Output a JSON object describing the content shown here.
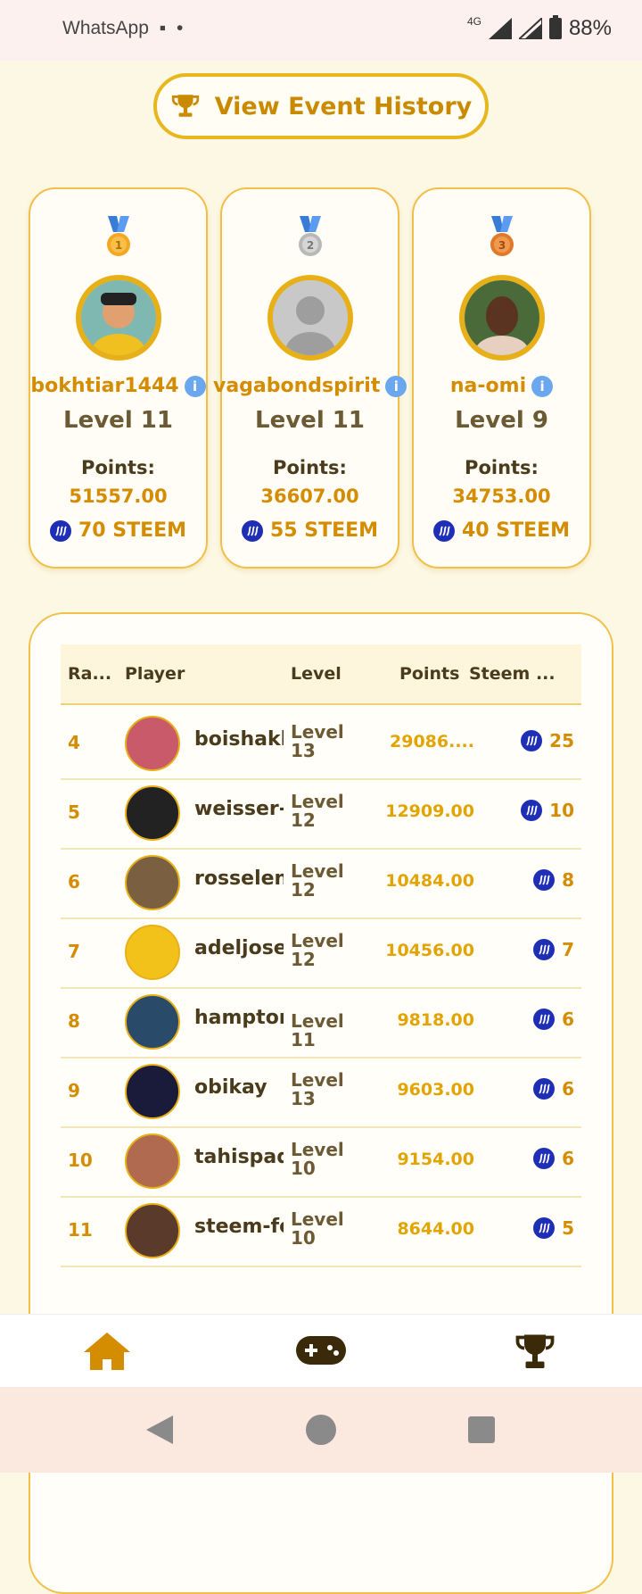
{
  "status_bar": {
    "left_text": "WhatsApp",
    "network": "4G",
    "battery": "88%"
  },
  "history_button": {
    "label": "View Event History"
  },
  "podium": [
    {
      "place": "1",
      "name": "bokhtiar1444",
      "level": "Level 11",
      "points_label": "Points:",
      "points": "51557.00",
      "reward": "70 STEEM",
      "medal_color": "#f5a623"
    },
    {
      "place": "2",
      "name": "vagabondspirit",
      "level": "Level 11",
      "points_label": "Points:",
      "points": "36607.00",
      "reward": "55 STEEM",
      "medal_color": "#b8b8b8"
    },
    {
      "place": "3",
      "name": "na-omi",
      "level": "Level 9",
      "points_label": "Points:",
      "points": "34753.00",
      "reward": "40 STEEM",
      "medal_color": "#e07a2a"
    }
  ],
  "table": {
    "headers": {
      "rank": "Ra...",
      "player": "Player",
      "level": "Level",
      "points": "Points",
      "steem": "Steem ..."
    },
    "rows": [
      {
        "rank": "4",
        "player": "boishakhi",
        "level": "Level 13",
        "points": "29086....",
        "steem": "25"
      },
      {
        "rank": "5",
        "player": "weisser-r",
        "level": "Level 12",
        "points": "12909.00",
        "steem": "10"
      },
      {
        "rank": "6",
        "player": "rosselena",
        "level": "Level 12",
        "points": "10484.00",
        "steem": "8"
      },
      {
        "rank": "7",
        "player": "adeljose",
        "level": "Level 12",
        "points": "10456.00",
        "steem": "7"
      },
      {
        "rank": "8",
        "player": "hamptonc",
        "level": "Level 11",
        "points": "9818.00",
        "steem": "6"
      },
      {
        "rank": "9",
        "player": "obikay",
        "level": "Level 13",
        "points": "9603.00",
        "steem": "6"
      },
      {
        "rank": "10",
        "player": "tahispadr",
        "level": "Level 10",
        "points": "9154.00",
        "steem": "6"
      },
      {
        "rank": "11",
        "player": "steem-for",
        "level": "Level 10",
        "points": "8644.00",
        "steem": "5"
      }
    ]
  },
  "bottom_nav": {
    "items": [
      "home-icon",
      "gamepad-icon",
      "trophy-icon"
    ]
  },
  "colors": {
    "accent": "#e8b018",
    "text_gold": "#d48c00",
    "steem": "#1f2fb5"
  }
}
